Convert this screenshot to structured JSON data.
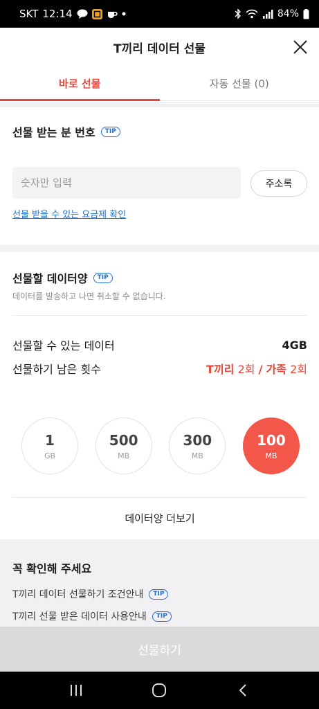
{
  "status_bar": {
    "carrier": "SKT",
    "time": "12:14",
    "battery": "84%"
  },
  "header": {
    "title": "T끼리 데이터 선물"
  },
  "tabs": [
    {
      "label": "바로 선물",
      "active": true
    },
    {
      "label": "자동 선물 (0)",
      "active": false
    }
  ],
  "recipient": {
    "title": "선물 받는 분 번호",
    "tip": "TIP",
    "input_placeholder": "숫자만 입력",
    "address_book_label": "주소록",
    "plan_check_link": "선물 받을 수 있는 요금제 확인"
  },
  "data_amount": {
    "title": "선물할 데이터양",
    "tip": "TIP",
    "note": "데이터를 발송하고 나면 취소할 수 없습니다.",
    "available_label": "선물할 수 있는 데이터",
    "available_value": "4GB",
    "remaining_label": "선물하기 남은 횟수",
    "remaining_tkiri": "T끼리",
    "remaining_tkiri_count": "2회",
    "remaining_sep": "/",
    "remaining_family": "가족",
    "remaining_family_count": "2회",
    "options": [
      {
        "value": "1",
        "unit": "GB",
        "selected": false
      },
      {
        "value": "500",
        "unit": "MB",
        "selected": false
      },
      {
        "value": "300",
        "unit": "MB",
        "selected": false
      },
      {
        "value": "100",
        "unit": "MB",
        "selected": true
      }
    ],
    "more_label": "데이터양 더보기"
  },
  "notice": {
    "title": "꼭 확인해 주세요",
    "items": [
      {
        "label": "T끼리 데이터 선물하기 조건안내",
        "tip": "TIP"
      },
      {
        "label": "T끼리 선물 받은 데이터 사용안내",
        "tip": "TIP"
      }
    ]
  },
  "gift_button_label": "선물하기",
  "colors": {
    "accent": "#e8463a",
    "selected_circle": "#f2574a",
    "link": "#1f6fd1",
    "disabled_button": "#dadada"
  }
}
